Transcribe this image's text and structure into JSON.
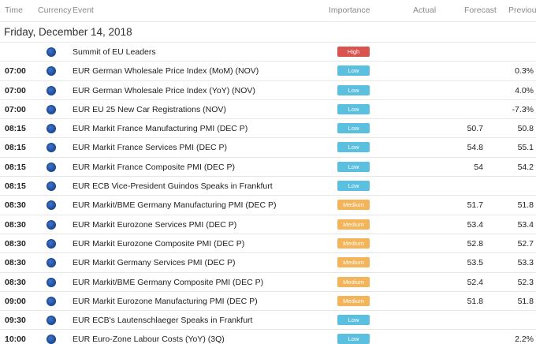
{
  "columns": {
    "time": "Time",
    "currency": "Currency",
    "event": "Event",
    "importance": "Importance",
    "actual": "Actual",
    "forecast": "Forecast",
    "previous": "Previous"
  },
  "date_header": "Friday, December 14, 2018",
  "colors": {
    "low": "#5bbfe0",
    "medium": "#f4b45a",
    "high": "#d9534f",
    "flag": "#1f4f9e"
  },
  "rows": [
    {
      "time": "",
      "currency_icon": "eu-flag-icon",
      "event": "Summit of EU Leaders",
      "importance": "High",
      "importance_level": "high",
      "actual": "",
      "forecast": "",
      "previous": ""
    },
    {
      "time": "07:00",
      "currency_icon": "eu-flag-icon",
      "event": "EUR German Wholesale Price Index (MoM) (NOV)",
      "importance": "Low",
      "importance_level": "low",
      "actual": "",
      "forecast": "",
      "previous": "0.3%"
    },
    {
      "time": "07:00",
      "currency_icon": "eu-flag-icon",
      "event": "EUR German Wholesale Price Index (YoY) (NOV)",
      "importance": "Low",
      "importance_level": "low",
      "actual": "",
      "forecast": "",
      "previous": "4.0%"
    },
    {
      "time": "07:00",
      "currency_icon": "eu-flag-icon",
      "event": "EUR EU 25 New Car Registrations (NOV)",
      "importance": "Low",
      "importance_level": "low",
      "actual": "",
      "forecast": "",
      "previous": "-7.3%"
    },
    {
      "time": "08:15",
      "currency_icon": "eu-flag-icon",
      "event": "EUR Markit France Manufacturing PMI (DEC P)",
      "importance": "Low",
      "importance_level": "low",
      "actual": "",
      "forecast": "50.7",
      "previous": "50.8"
    },
    {
      "time": "08:15",
      "currency_icon": "eu-flag-icon",
      "event": "EUR Markit France Services PMI (DEC P)",
      "importance": "Low",
      "importance_level": "low",
      "actual": "",
      "forecast": "54.8",
      "previous": "55.1"
    },
    {
      "time": "08:15",
      "currency_icon": "eu-flag-icon",
      "event": "EUR Markit France Composite PMI (DEC P)",
      "importance": "Low",
      "importance_level": "low",
      "actual": "",
      "forecast": "54",
      "previous": "54.2"
    },
    {
      "time": "08:15",
      "currency_icon": "eu-flag-icon",
      "event": "EUR ECB Vice-President Guindos Speaks in Frankfurt",
      "importance": "Low",
      "importance_level": "low",
      "actual": "",
      "forecast": "",
      "previous": ""
    },
    {
      "time": "08:30",
      "currency_icon": "eu-flag-icon",
      "event": "EUR Markit/BME Germany Manufacturing PMI (DEC P)",
      "importance": "Medium",
      "importance_level": "medium",
      "actual": "",
      "forecast": "51.7",
      "previous": "51.8"
    },
    {
      "time": "08:30",
      "currency_icon": "eu-flag-icon",
      "event": "EUR Markit Eurozone Services PMI (DEC P)",
      "importance": "Medium",
      "importance_level": "medium",
      "actual": "",
      "forecast": "53.4",
      "previous": "53.4"
    },
    {
      "time": "08:30",
      "currency_icon": "eu-flag-icon",
      "event": "EUR Markit Eurozone Composite PMI (DEC P)",
      "importance": "Medium",
      "importance_level": "medium",
      "actual": "",
      "forecast": "52.8",
      "previous": "52.7"
    },
    {
      "time": "08:30",
      "currency_icon": "eu-flag-icon",
      "event": "EUR Markit Germany Services PMI (DEC P)",
      "importance": "Medium",
      "importance_level": "medium",
      "actual": "",
      "forecast": "53.5",
      "previous": "53.3"
    },
    {
      "time": "08:30",
      "currency_icon": "eu-flag-icon",
      "event": "EUR Markit/BME Germany Composite PMI (DEC P)",
      "importance": "Medium",
      "importance_level": "medium",
      "actual": "",
      "forecast": "52.4",
      "previous": "52.3"
    },
    {
      "time": "09:00",
      "currency_icon": "eu-flag-icon",
      "event": "EUR Markit Eurozone Manufacturing PMI (DEC P)",
      "importance": "Medium",
      "importance_level": "medium",
      "actual": "",
      "forecast": "51.8",
      "previous": "51.8"
    },
    {
      "time": "09:30",
      "currency_icon": "eu-flag-icon",
      "event": "EUR ECB's Lautenschlaeger Speaks in Frankfurt",
      "importance": "Low",
      "importance_level": "low",
      "actual": "",
      "forecast": "",
      "previous": ""
    },
    {
      "time": "10:00",
      "currency_icon": "eu-flag-icon",
      "event": "EUR Euro-Zone Labour Costs (YoY) (3Q)",
      "importance": "Low",
      "importance_level": "low",
      "actual": "",
      "forecast": "",
      "previous": "2.2%"
    }
  ]
}
